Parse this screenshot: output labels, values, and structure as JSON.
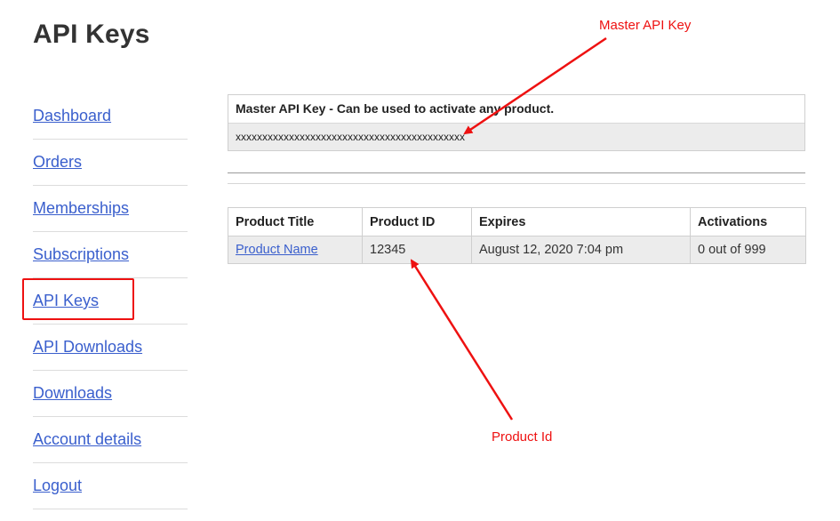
{
  "page": {
    "title": "API Keys"
  },
  "sidebar": {
    "items": [
      {
        "label": "Dashboard"
      },
      {
        "label": "Orders"
      },
      {
        "label": "Memberships"
      },
      {
        "label": "Subscriptions"
      },
      {
        "label": "API Keys"
      },
      {
        "label": "API Downloads"
      },
      {
        "label": "Downloads"
      },
      {
        "label": "Account details"
      },
      {
        "label": "Logout"
      }
    ]
  },
  "master_key": {
    "heading": "Master API Key - Can be used to activate any product.",
    "value": "xxxxxxxxxxxxxxxxxxxxxxxxxxxxxxxxxxxxxxxxxxx"
  },
  "products_table": {
    "headers": [
      "Product Title",
      "Product ID",
      "Expires",
      "Activations"
    ],
    "rows": [
      {
        "title": "Product Name",
        "id": "12345",
        "expires": "August 12, 2020 7:04 pm",
        "activations": "0 out of 999"
      }
    ]
  },
  "annotations": {
    "master_label": "Master API Key",
    "product_label": "Product Id",
    "color": "#ee1111"
  }
}
